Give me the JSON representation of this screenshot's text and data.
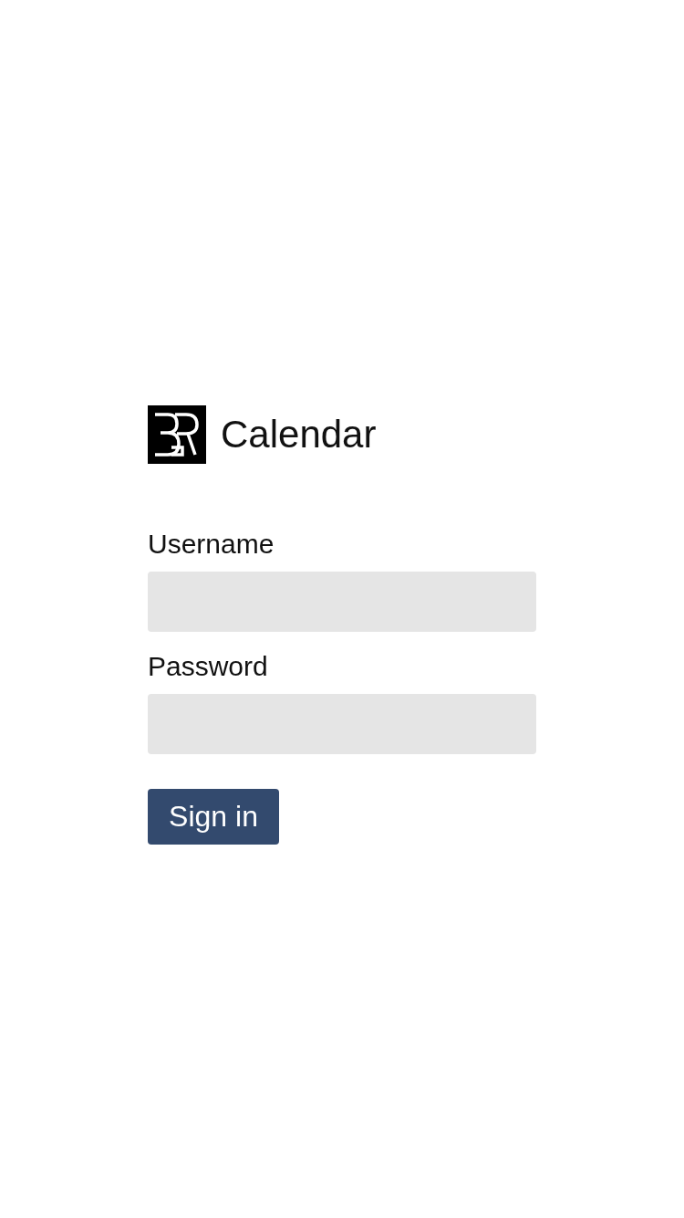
{
  "app": {
    "title": "Calendar"
  },
  "fields": [
    {
      "label": "Username"
    },
    {
      "label": "Password"
    }
  ],
  "submit": {
    "label": "Sign in"
  }
}
